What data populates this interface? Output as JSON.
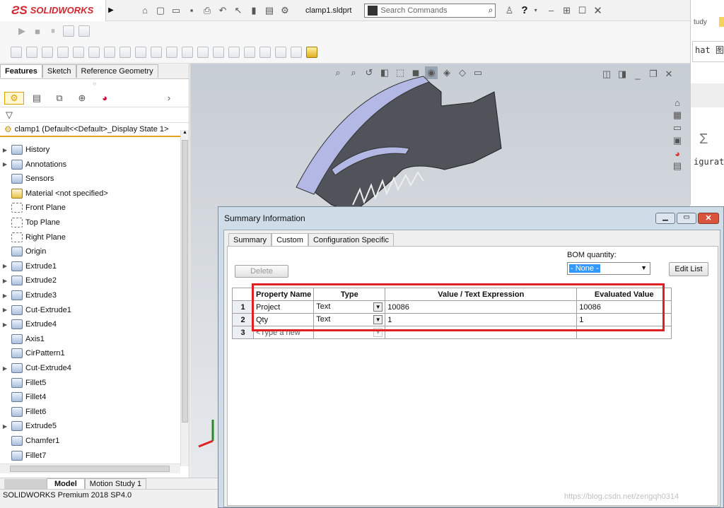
{
  "titlebar": {
    "brand": "SOLIDWORKS",
    "filename": "clamp1.sldprt",
    "search_placeholder": "Search Commands",
    "help": "?"
  },
  "background_window": {
    "text1": "tudy",
    "text2": "hat 图",
    "text3": "igurat",
    "sigma": "Σ"
  },
  "panel_tabs": [
    "Features",
    "Sketch",
    "Reference Geometry"
  ],
  "tree": {
    "root": "clamp1  (Default<<Default>_Display State 1>",
    "items": [
      {
        "label": "History",
        "expandable": true
      },
      {
        "label": "Annotations",
        "expandable": true
      },
      {
        "label": "Sensors",
        "expandable": false
      },
      {
        "label": "Material <not specified>",
        "expandable": false
      },
      {
        "label": "Front Plane",
        "expandable": false
      },
      {
        "label": "Top Plane",
        "expandable": false
      },
      {
        "label": "Right Plane",
        "expandable": false
      },
      {
        "label": "Origin",
        "expandable": false
      },
      {
        "label": "Extrude1",
        "expandable": true
      },
      {
        "label": "Extrude2",
        "expandable": true
      },
      {
        "label": "Extrude3",
        "expandable": true
      },
      {
        "label": "Cut-Extrude1",
        "expandable": true
      },
      {
        "label": "Extrude4",
        "expandable": true
      },
      {
        "label": "Axis1",
        "expandable": false
      },
      {
        "label": "CirPattern1",
        "expandable": false
      },
      {
        "label": "Cut-Extrude4",
        "expandable": true
      },
      {
        "label": "Fillet5",
        "expandable": false
      },
      {
        "label": "Fillet4",
        "expandable": false
      },
      {
        "label": "Fillet6",
        "expandable": false
      },
      {
        "label": "Extrude5",
        "expandable": true
      },
      {
        "label": "Chamfer1",
        "expandable": false
      },
      {
        "label": "Fillet7",
        "expandable": false
      }
    ]
  },
  "bottom_tabs": [
    "Model",
    "Motion Study 1"
  ],
  "statusbar": "SOLIDWORKS Premium 2018 SP4.0",
  "dialog": {
    "title": "Summary Information",
    "tabs": [
      "Summary",
      "Custom",
      "Configuration Specific"
    ],
    "delete_label": "Delete",
    "bom_label": "BOM quantity:",
    "bom_value": "- None -",
    "edit_list_label": "Edit List",
    "columns": [
      "Property Name",
      "Type",
      "Value / Text Expression",
      "Evaluated Value"
    ],
    "rows": [
      {
        "num": "1",
        "name": "Project",
        "type": "Text",
        "value": "10086",
        "evaluated": "10086"
      },
      {
        "num": "2",
        "name": "Qty",
        "type": "Text",
        "value": "1",
        "evaluated": "1"
      },
      {
        "num": "3",
        "name": "<Type a new",
        "type": "",
        "value": "",
        "evaluated": ""
      }
    ],
    "watermark": "https://blog.csdn.net/zengqh0314"
  },
  "colors": {
    "brand_red": "#d2262e",
    "highlight_box": "#e02020",
    "selection_blue": "#3399ff"
  }
}
